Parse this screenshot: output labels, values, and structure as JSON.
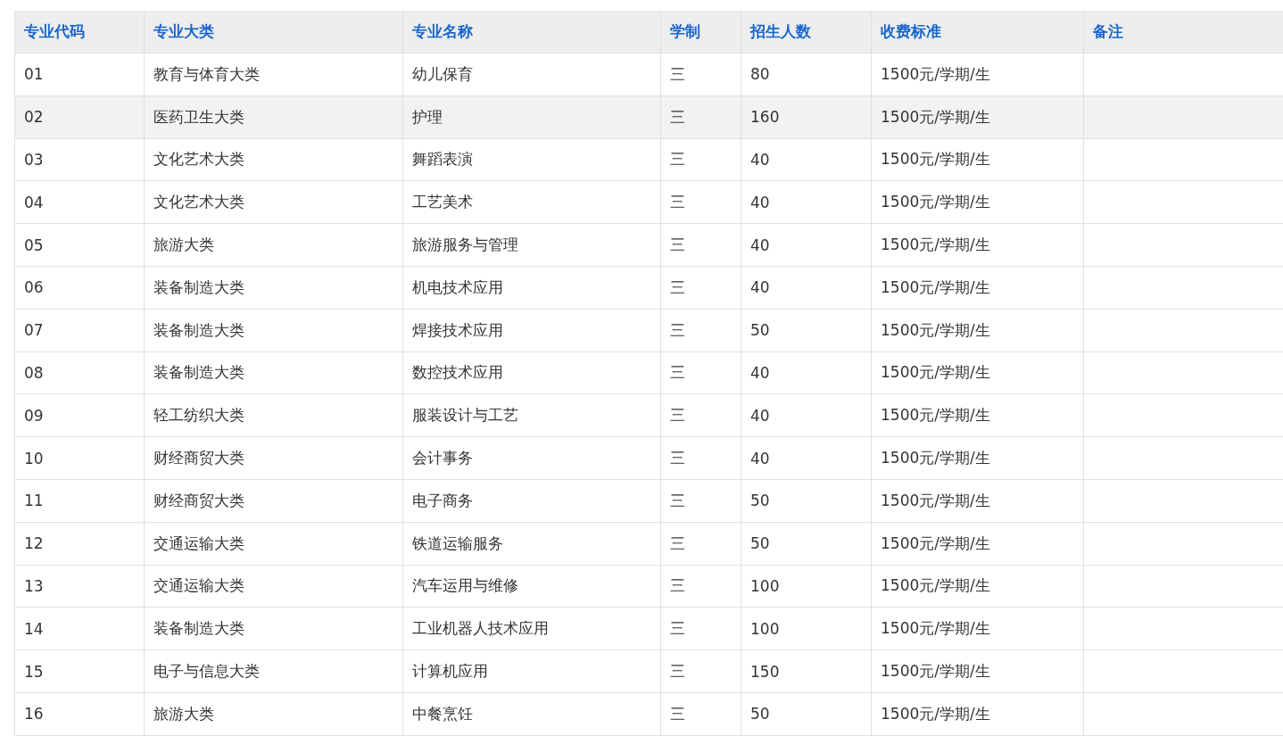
{
  "table": {
    "columns": [
      "专业代码",
      "专业大类",
      "专业名称",
      "学制",
      "招生人数",
      "收费标准",
      "备注"
    ],
    "rows": [
      {
        "selected": false,
        "cells": [
          "01",
          "教育与体育大类",
          "幼儿保育",
          "三",
          "80",
          "1500元/学期/生"
        ]
      },
      {
        "selected": true,
        "cells": [
          "02",
          "医药卫生大类",
          "护理",
          "三",
          "160",
          "1500元/学期/生"
        ]
      },
      {
        "selected": false,
        "cells": [
          "03",
          "文化艺术大类",
          "舞蹈表演",
          "三",
          "40",
          "1500元/学期/生"
        ]
      },
      {
        "selected": false,
        "cells": [
          "04",
          "文化艺术大类",
          "工艺美术",
          "三",
          "40",
          "1500元/学期/生"
        ]
      },
      {
        "selected": false,
        "cells": [
          "05",
          "旅游大类",
          "旅游服务与管理",
          "三",
          "40",
          "1500元/学期/生"
        ]
      },
      {
        "selected": false,
        "cells": [
          "06",
          "装备制造大类",
          "机电技术应用",
          "三",
          "40",
          "1500元/学期/生"
        ]
      },
      {
        "selected": false,
        "cells": [
          "07",
          "装备制造大类",
          "焊接技术应用",
          "三",
          "50",
          "1500元/学期/生"
        ]
      },
      {
        "selected": false,
        "cells": [
          "08",
          "装备制造大类",
          "数控技术应用",
          "三",
          "40",
          "1500元/学期/生"
        ]
      },
      {
        "selected": false,
        "cells": [
          "09",
          "轻工纺织大类",
          "服装设计与工艺",
          "三",
          "40",
          "1500元/学期/生"
        ]
      },
      {
        "selected": false,
        "cells": [
          "10",
          "财经商贸大类",
          "会计事务",
          "三",
          "40",
          "1500元/学期/生"
        ]
      },
      {
        "selected": false,
        "cells": [
          "11",
          "财经商贸大类",
          "电子商务",
          "三",
          "50",
          "1500元/学期/生"
        ]
      },
      {
        "selected": false,
        "cells": [
          "12",
          "交通运输大类",
          "铁道运输服务",
          "三",
          "50",
          "1500元/学期/生"
        ]
      },
      {
        "selected": false,
        "cells": [
          "13",
          "交通运输大类",
          "汽车运用与维修",
          "三",
          "100",
          "1500元/学期/生"
        ]
      },
      {
        "selected": false,
        "cells": [
          "14",
          "装备制造大类",
          "工业机器人技术应用",
          "三",
          "100",
          "1500元/学期/生"
        ]
      },
      {
        "selected": false,
        "cells": [
          "15",
          "电子与信息大类",
          "计算机应用",
          "三",
          "150",
          "1500元/学期/生"
        ]
      },
      {
        "selected": false,
        "cells": [
          "16",
          "旅游大类",
          "中餐烹饪",
          "三",
          "50",
          "1500元/学期/生"
        ]
      }
    ]
  }
}
